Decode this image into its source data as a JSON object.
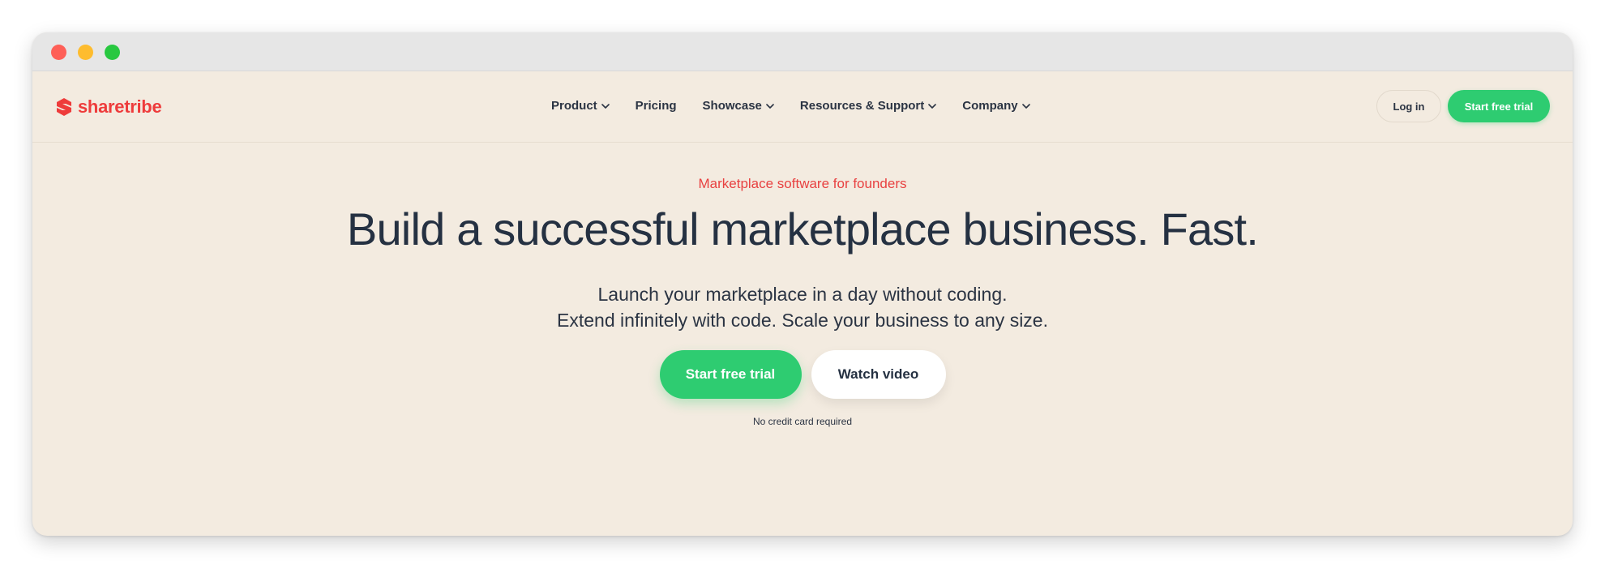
{
  "window": {
    "controls": [
      "close",
      "minimize",
      "zoom"
    ]
  },
  "brand": {
    "name": "sharetribe",
    "color": "#ee3b3b"
  },
  "nav": {
    "items": [
      {
        "label": "Product",
        "dropdown": true
      },
      {
        "label": "Pricing",
        "dropdown": false
      },
      {
        "label": "Showcase",
        "dropdown": true
      },
      {
        "label": "Resources & Support",
        "dropdown": true
      },
      {
        "label": "Company",
        "dropdown": true
      }
    ],
    "login_label": "Log in",
    "trial_label": "Start free trial"
  },
  "hero": {
    "eyebrow": "Marketplace software for founders",
    "headline": "Build a successful marketplace business. Fast.",
    "subline_1": "Launch your marketplace in a day without coding.",
    "subline_2": "Extend infinitely with code. Scale your business to any size.",
    "primary_cta": "Start free trial",
    "secondary_cta": "Watch video",
    "note": "No credit card required"
  },
  "colors": {
    "accent_green": "#2ecc71",
    "accent_red": "#e84141",
    "background": "#f3ebe0",
    "text_dark": "#253142"
  }
}
